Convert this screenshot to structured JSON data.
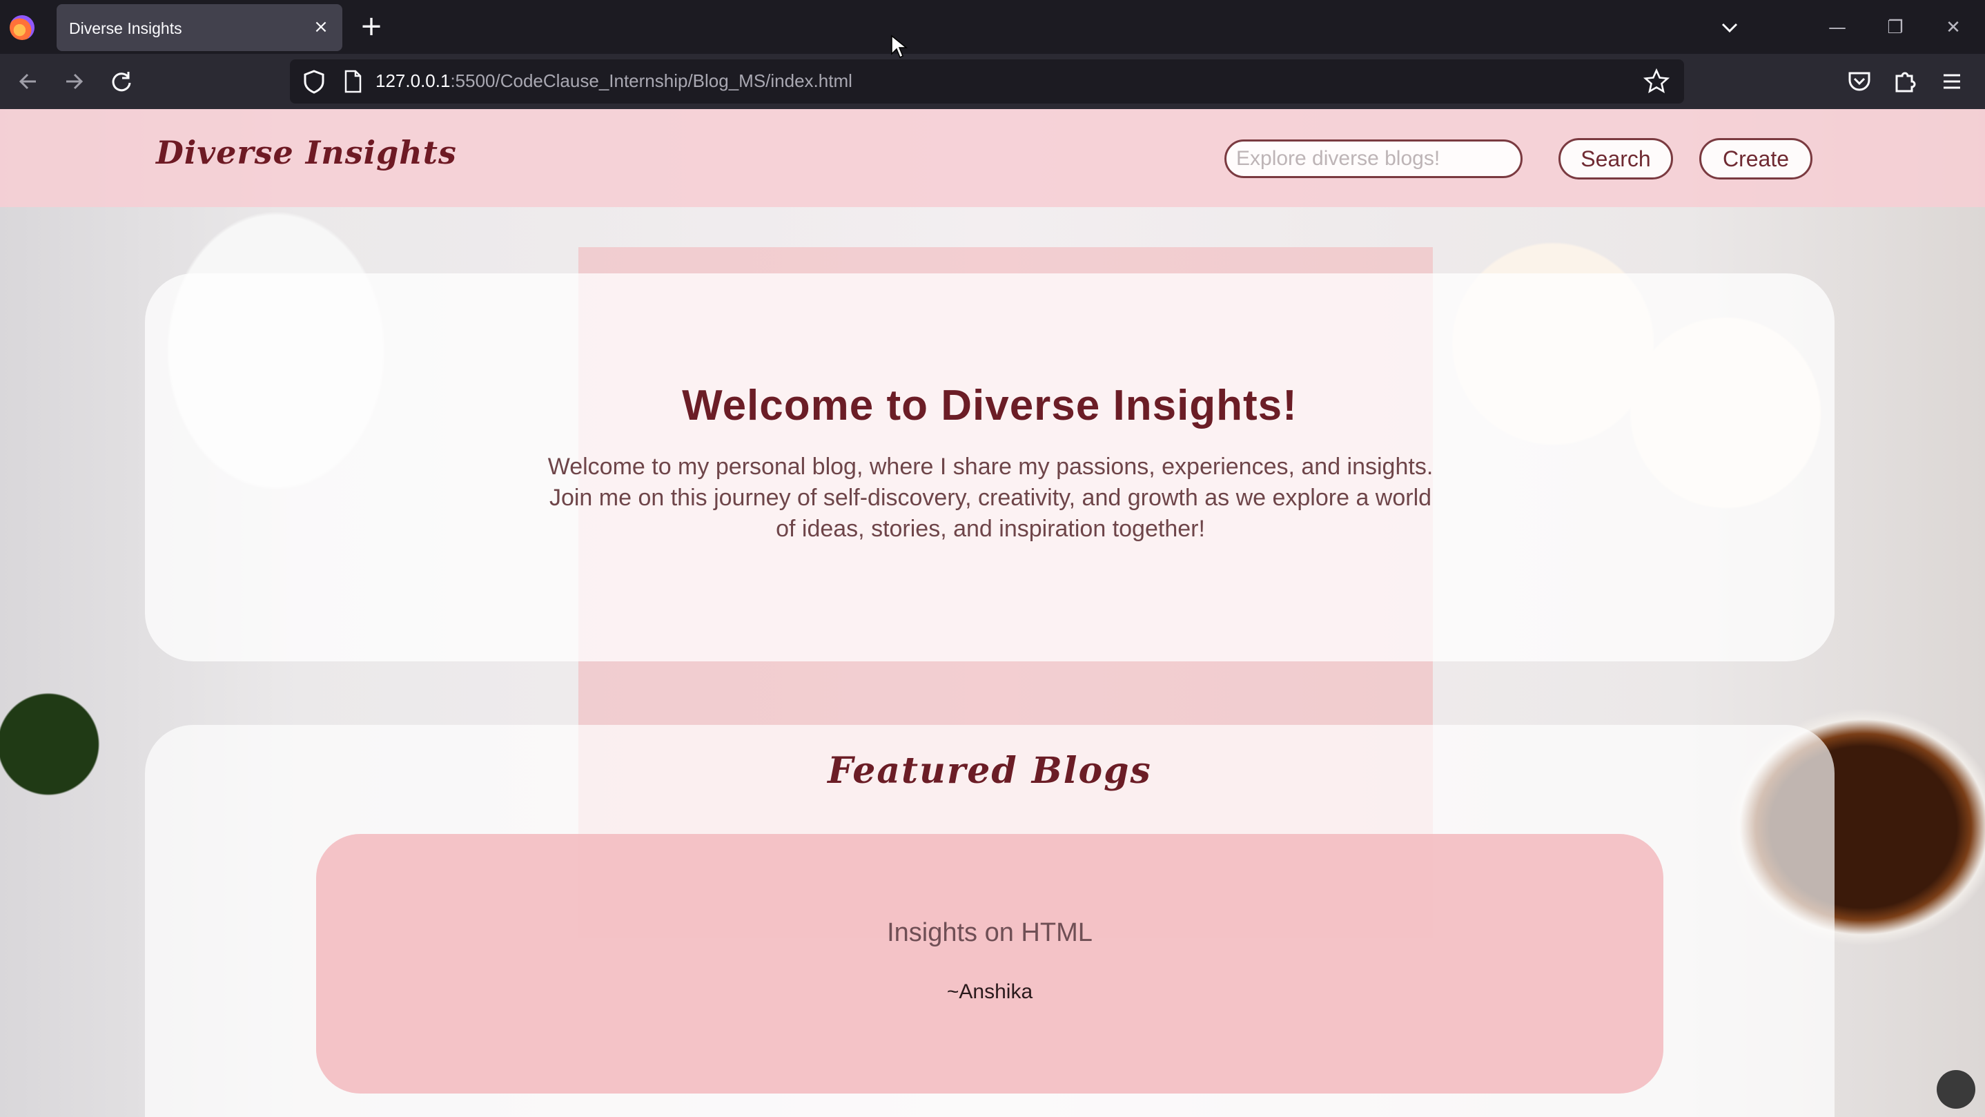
{
  "browser": {
    "tab_title": "Diverse Insights",
    "url_host": "127.0.0.1",
    "url_rest": ":5500/CodeClause_Internship/Blog_MS/index.html",
    "icons": {
      "close_tab": "×",
      "new_tab": "+",
      "minimize": "—",
      "restore": "❐",
      "close_window": "✕"
    }
  },
  "site": {
    "logo": "Diverse Insights",
    "search_placeholder": "Explore diverse blogs!",
    "search_button": "Search",
    "create_button": "Create"
  },
  "welcome": {
    "title": "Welcome to Diverse Insights!",
    "text": "Welcome to my personal blog, where I share my passions, experiences, and insights. Join me on this journey of self-discovery, creativity, and growth as we explore a world of ideas, stories, and inspiration together!"
  },
  "featured": {
    "title": "Featured Blogs",
    "posts": [
      {
        "title": "Insights on HTML",
        "author": "~Anshika"
      }
    ]
  },
  "colors": {
    "accent": "#6b1d26",
    "header_bg": "#f6ced4",
    "card_pink": "#f3bec2"
  }
}
